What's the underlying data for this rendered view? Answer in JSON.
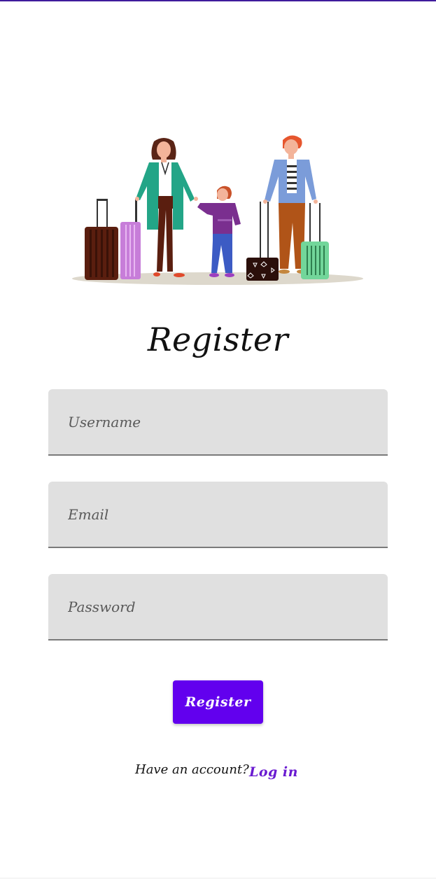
{
  "header": {
    "title": "Register"
  },
  "illustration": {
    "icon": "family-travel-illustration"
  },
  "form": {
    "username_placeholder": "Username",
    "email_placeholder": "Email",
    "password_placeholder": "Password",
    "submit_label": "Register"
  },
  "footer": {
    "have_account_text": "Have an account?",
    "login_label": "Log in"
  },
  "colors": {
    "primary": "#6200ee",
    "link": "#6a1bd1",
    "field_background": "#e0e0e0",
    "top_bar": "#3f1b9c"
  }
}
